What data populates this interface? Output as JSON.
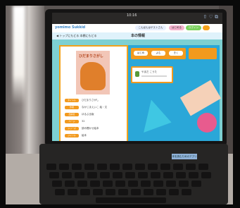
{
  "statusbar": {
    "time": "10:16",
    "icons": "⇧ ♡ ⧉"
  },
  "appbar": {
    "logo": "yomimo Sukkid",
    "pills": [
      {
        "label": "こんばんはゲストさん",
        "color": "#e8f0ff"
      },
      {
        "label": "はじめる",
        "color": "#f4b1cd"
      },
      {
        "label": "ログイン",
        "color": "#7bd15d"
      },
      {
        "label": "",
        "color": "#f6a21c"
      }
    ]
  },
  "subbar": {
    "back": "◀ トップにもどる  本棚にもどる",
    "title": "本の情報"
  },
  "book": {
    "title": "ひだまりさがし"
  },
  "meta": [
    {
      "label": "タイトル",
      "value": "ひだまりさがし"
    },
    {
      "label": "作者",
      "value": "なかじまえいこ 絵・文"
    },
    {
      "label": "出版社",
      "value": "ほるぷ出版"
    },
    {
      "label": "ページ",
      "value": "32"
    },
    {
      "label": "シリーズ",
      "value": "読み聞かせ絵本"
    },
    {
      "label": "ジャンル",
      "value": "絵本"
    }
  ],
  "right": {
    "tabs": [
      "はじめ",
      "よむ",
      "きく"
    ],
    "voice_title": "やまだ こうた"
  },
  "keyboard": {
    "brand": "本を読むためのアプリ"
  },
  "colors": {
    "accent": "#f29a1e",
    "teal": "#7dd0d2",
    "blue": "#2aa7d8"
  }
}
